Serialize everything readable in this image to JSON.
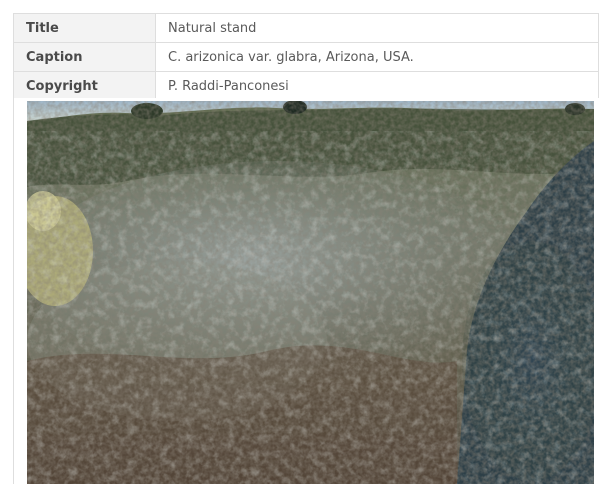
{
  "metadata": {
    "rows": [
      {
        "label": "Title",
        "value": "Natural stand"
      },
      {
        "label": "Caption",
        "value": "C. arizonica var. glabra, Arizona, USA."
      },
      {
        "label": "Copyright",
        "value": "P. Raddi-Panconesi"
      }
    ]
  },
  "photo": {
    "subject": "natural stand of cypress on a hillside"
  }
}
